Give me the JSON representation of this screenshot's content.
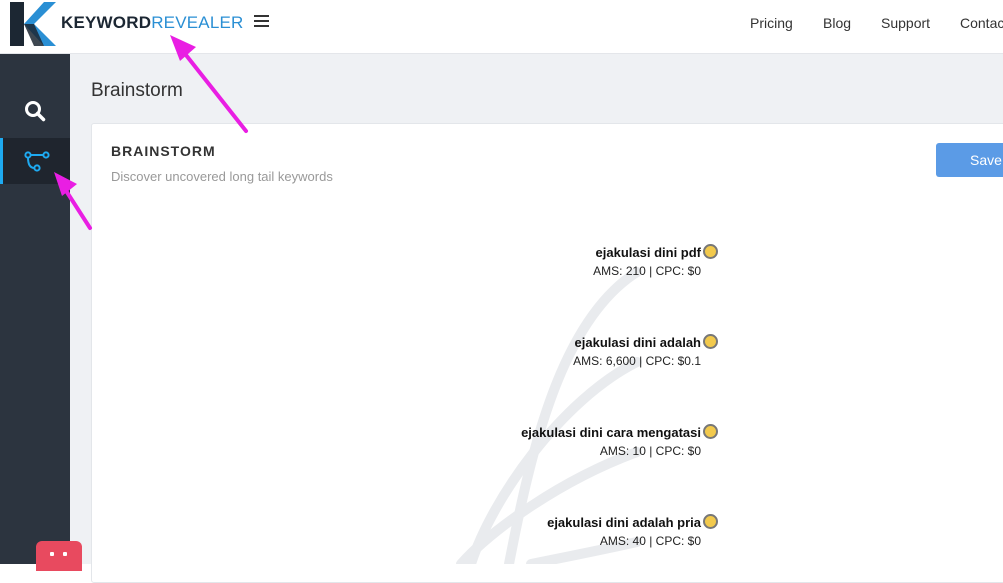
{
  "brand": {
    "part1": "KEYWORD",
    "part2": "REVEALER",
    "logo_color": "#2a8fd4"
  },
  "nav": {
    "pricing": "Pricing",
    "blog": "Blog",
    "support": "Support",
    "contact": "Contact"
  },
  "sidebar": {
    "items": [
      {
        "icon": "search-icon",
        "active": false
      },
      {
        "icon": "brainstorm-icon",
        "active": true
      }
    ]
  },
  "page": {
    "title": "Brainstorm"
  },
  "card": {
    "title": "BRAINSTORM",
    "subtitle": "Discover uncovered long tail keywords",
    "save_label": "Save"
  },
  "keywords": [
    {
      "name": "ejakulasi dini pdf",
      "stats": "AMS: 210 | CPC: $0"
    },
    {
      "name": "ejakulasi dini adalah",
      "stats": "AMS: 6,600 | CPC: $0.1"
    },
    {
      "name": "ejakulasi dini cara mengatasi",
      "stats": "AMS: 10 | CPC: $0"
    },
    {
      "name": "ejakulasi dini adalah pria",
      "stats": "AMS: 40 | CPC: $0"
    }
  ],
  "colors": {
    "accent": "#1eaaf1",
    "node": "#f2c94c",
    "save_button": "#5b9be6",
    "annotation_arrow": "#e91ee3",
    "chat": "#e84a5f"
  }
}
